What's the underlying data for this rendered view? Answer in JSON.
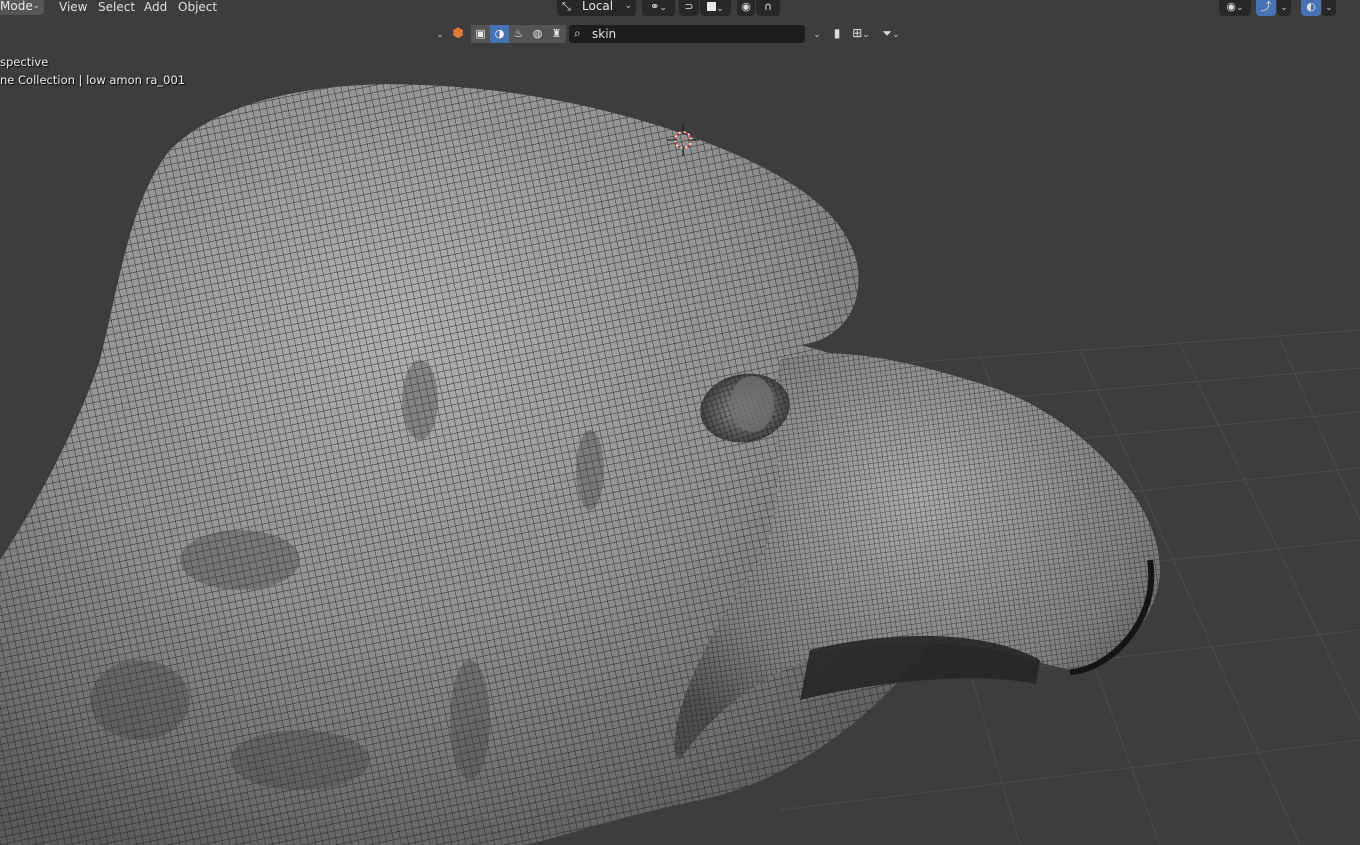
{
  "header": {
    "mode_label": "Mode",
    "menu": [
      "View",
      "Select",
      "Add",
      "Object"
    ],
    "pivot_label": "Local"
  },
  "toolbar2": {
    "search_value": "skin"
  },
  "viewport": {
    "view_name": "spective",
    "collection_info": "ne Collection | low amon ra_001"
  },
  "icons": {
    "viewport_shading": [
      "solid-icon",
      "material-icon",
      "rendered-icon",
      "wireframe-icon"
    ],
    "right_tools": [
      "visibility-icon",
      "gizmo-icon",
      "overlay-icon"
    ]
  },
  "colors": {
    "background": "#3d3d3d",
    "accent": "#4772b3",
    "mesh_base": "#8c8c8c",
    "wire": "#222222",
    "cursor": "#c83c3c"
  }
}
